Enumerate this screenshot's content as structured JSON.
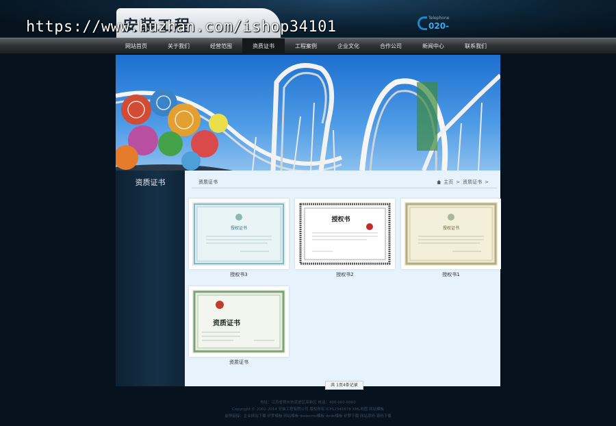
{
  "header": {
    "logo_text": "安装工程",
    "watermark": "https://www.huzhan.com/ishop34101",
    "phone_label": "Telephone",
    "phone_number": "020-"
  },
  "nav": {
    "items": [
      "网站首页",
      "关于我们",
      "经营范围",
      "资质证书",
      "工程案例",
      "企业文化",
      "合作公司",
      "新闻中心",
      "联系我们"
    ],
    "active_index": 3
  },
  "sidebar": {
    "title": "资质证书"
  },
  "main": {
    "section_title": "资质证书",
    "breadcrumb": {
      "home": "主页",
      "sep": ">",
      "current": "资质证书"
    }
  },
  "certificates": [
    {
      "label": "授权书3",
      "style": "blue-cert",
      "heading": "授权证书"
    },
    {
      "label": "授权书2",
      "style": "grey-cert",
      "heading": "授权书"
    },
    {
      "label": "授权书1",
      "style": "gold-cert",
      "heading": "授权证书"
    },
    {
      "label": "资质证书",
      "style": "green-cert",
      "heading": "资质证书"
    }
  ],
  "pager": {
    "text": "共 1页4条记录"
  },
  "footer": {
    "line1": "地址：江苏省常州市武进区高新区 电话：400-000-0000",
    "line2": "Copyright © 2002-2014 安装工程有限公司 版权所有 ICP12345678 XML地图 网站模板",
    "line3": "友情链接：企业网站下载  织梦模板  网站模板  dedecms模板  dede模板  织梦下载  网站源码  源码下载"
  },
  "colors": {
    "accent": "#1a8ad0",
    "page_bg": "#06121d",
    "content_bg": "#e7f3fc"
  }
}
